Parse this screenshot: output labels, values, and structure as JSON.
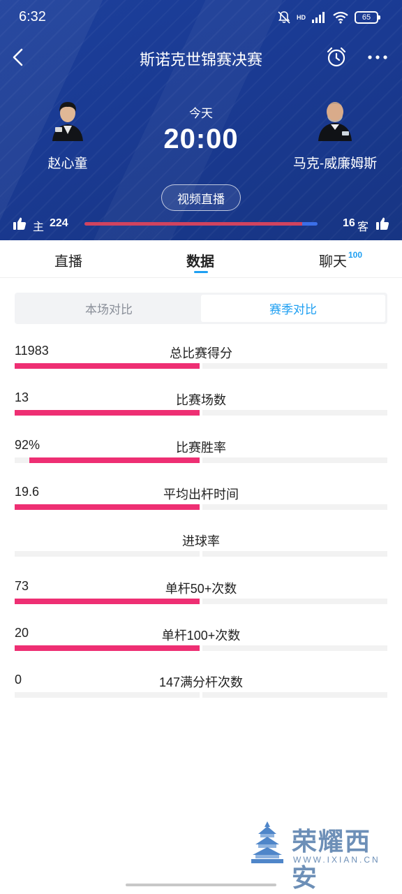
{
  "status_bar": {
    "time": "6:32",
    "battery": "65",
    "network": "HD"
  },
  "nav": {
    "title": "斯诺克世锦赛决赛"
  },
  "match": {
    "home_player": "赵心童",
    "away_player": "马克-威廉姆斯",
    "day": "今天",
    "time": "20:00",
    "live_button": "视频直播"
  },
  "votes": {
    "home_label": "主",
    "home_count": "224",
    "away_count": "16",
    "away_label": "客",
    "home_share": 0.933,
    "colors": {
      "home": "#d0435f",
      "away": "#3b6fe8"
    }
  },
  "tabs": [
    {
      "label": "直播"
    },
    {
      "label": "数据"
    },
    {
      "label": "聊天"
    }
  ],
  "chat_badge": "100",
  "segment": {
    "options": [
      "本场对比",
      "赛季对比"
    ],
    "selected": "赛季对比"
  },
  "stats": [
    {
      "label": "总比赛得分",
      "home": "11983",
      "home_fill": 1.0
    },
    {
      "label": "比赛场数",
      "home": "13",
      "home_fill": 1.0
    },
    {
      "label": "比赛胜率",
      "home": "92%",
      "home_fill": 0.92
    },
    {
      "label": "平均出杆时间",
      "home": "19.6",
      "home_fill": 1.0
    },
    {
      "label": "进球率",
      "home": "",
      "home_fill": 0
    },
    {
      "label": "单杆50+次数",
      "home": "73",
      "home_fill": 1.0
    },
    {
      "label": "单杆100+次数",
      "home": "20",
      "home_fill": 1.0
    },
    {
      "label": "147满分杆次数",
      "home": "0",
      "home_fill": 0
    }
  ],
  "accent": "#1e9ff2",
  "bar_color": "#ee2f73",
  "watermark": {
    "text": "荣耀西安",
    "url": "WWW.IXIAN.CN"
  }
}
